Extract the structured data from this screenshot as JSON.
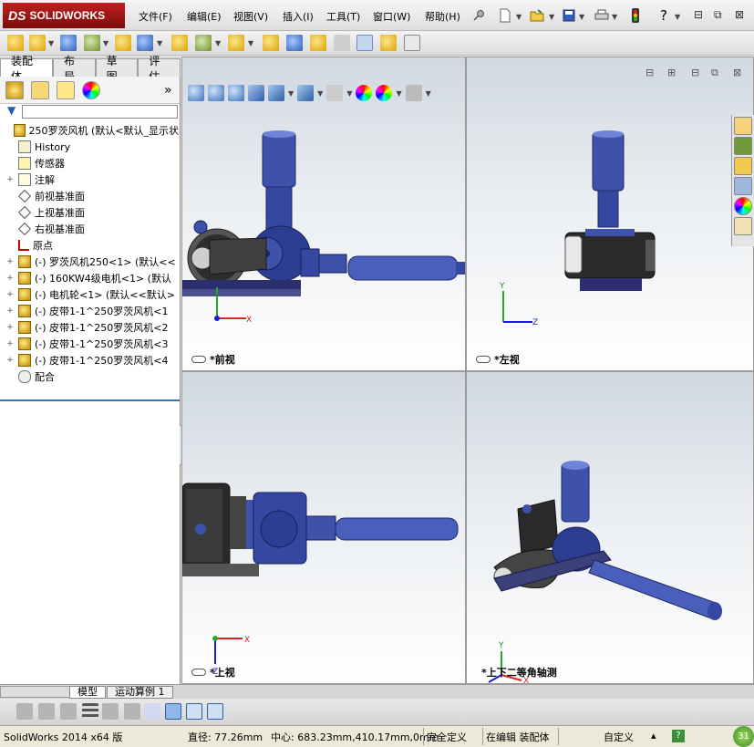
{
  "app": {
    "brand_ds": "DS",
    "brand_name": "SOLIDWORKS"
  },
  "menu": [
    "文件(F)",
    "编辑(E)",
    "视图(V)",
    "插入(I)",
    "工具(T)",
    "窗口(W)",
    "帮助(H)"
  ],
  "menu_icons": [
    "pin-icon",
    "new-document-icon",
    "open-folder-icon",
    "save-icon",
    "print-icon",
    "rebuild-traffic-light-icon",
    "help-icon",
    "options-icon"
  ],
  "window_controls": {
    "minimize": "⊟",
    "restore": "⧉",
    "close": "⊠"
  },
  "cm_tabs": [
    "装配体",
    "布局",
    "草图",
    "评估"
  ],
  "cm_active_tab": 0,
  "panel_icons": [
    "featuremanager-tree-icon",
    "propertymanager-icon",
    "configurationmanager-icon",
    "dimxpert-icon",
    "appearance-icon"
  ],
  "panel_expand": "»",
  "filter_icon": "funnel-icon",
  "tree": [
    {
      "label": "250罗茨风机   (默认<默认_显示状",
      "icon": "assembly-icon",
      "level": 0,
      "expand": ""
    },
    {
      "label": "History",
      "icon": "history-icon",
      "level": 1,
      "expand": ""
    },
    {
      "label": "传感器",
      "icon": "sensor-icon",
      "level": 1,
      "expand": ""
    },
    {
      "label": "注解",
      "icon": "annotation-icon",
      "level": 1,
      "expand": "+"
    },
    {
      "label": "前视基准面",
      "icon": "plane-icon",
      "level": 1,
      "expand": ""
    },
    {
      "label": "上视基准面",
      "icon": "plane-icon",
      "level": 1,
      "expand": ""
    },
    {
      "label": "右视基准面",
      "icon": "plane-icon",
      "level": 1,
      "expand": ""
    },
    {
      "label": "原点",
      "icon": "origin-icon",
      "level": 1,
      "expand": ""
    },
    {
      "label": "(-) 罗茨风机250<1> (默认<<",
      "icon": "assembly-icon",
      "level": 1,
      "expand": "+"
    },
    {
      "label": "(-) 160KW4级电机<1> (默认",
      "icon": "assembly-icon",
      "level": 1,
      "expand": "+"
    },
    {
      "label": "(-) 电机轮<1> (默认<<默认>",
      "icon": "assembly-icon",
      "level": 1,
      "expand": "+"
    },
    {
      "label": "(-) 皮带1-1^250罗茨风机<1",
      "icon": "assembly-icon",
      "level": 1,
      "expand": "+"
    },
    {
      "label": "(-) 皮带1-1^250罗茨风机<2",
      "icon": "assembly-icon",
      "level": 1,
      "expand": "+"
    },
    {
      "label": "(-) 皮带1-1^250罗茨风机<3",
      "icon": "assembly-icon",
      "level": 1,
      "expand": "+"
    },
    {
      "label": "(-) 皮带1-1^250罗茨风机<4",
      "icon": "assembly-icon",
      "level": 1,
      "expand": "+"
    },
    {
      "label": "配合",
      "icon": "mates-icon",
      "level": 1,
      "expand": ""
    }
  ],
  "views": {
    "front": "*前视",
    "left": "*左视",
    "top": "*上视",
    "iso": "*上下二等角轴测"
  },
  "axis_labels": {
    "x": "X",
    "y": "Y",
    "z": "Z"
  },
  "bottom_tabs": [
    "模型",
    "运动算例 1"
  ],
  "bottom_active_tab": 0,
  "status": {
    "product": "SolidWorks 2014 x64 版",
    "diameter": "直径: 77.26mm",
    "center": "中心: 683.23mm,410.17mm,0mm",
    "defined": "完全定义",
    "editing": "在编辑 装配体",
    "units": "自定义",
    "units_caret": "▴",
    "help": "?",
    "badge": "31"
  },
  "colors": {
    "part_blue": "#3b4fa8",
    "part_dark": "#27357a",
    "frame": "#2c2f6e",
    "highlight": "#8fa3e8"
  }
}
